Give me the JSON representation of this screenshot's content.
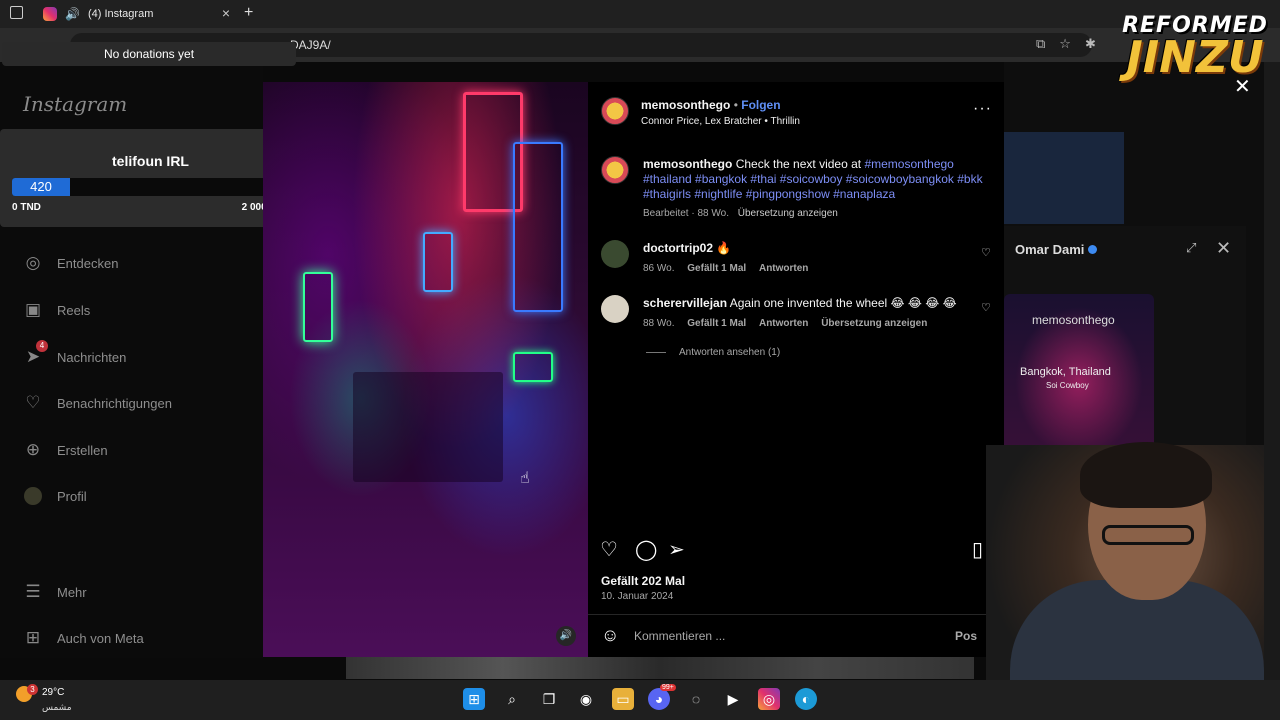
{
  "browser": {
    "tab_title": "(4) Instagram",
    "url_fragment": "DAJ9A/"
  },
  "overlay": {
    "donations_text": "No donations yet",
    "goal": {
      "title": "telifoun IRL",
      "current": "420",
      "min_label": "0 TND",
      "max_label": "2 000 TND",
      "progress_fraction": 0.21
    },
    "logo_line1": "REFORMED",
    "logo_line2": "JINZU"
  },
  "sidebar": {
    "logo": "Instagram",
    "items": [
      {
        "label": "Entdecken",
        "icon": "compass-icon"
      },
      {
        "label": "Reels",
        "icon": "reels-icon"
      },
      {
        "label": "Nachrichten",
        "icon": "messenger-icon",
        "badge": "4"
      },
      {
        "label": "Benachrichtigungen",
        "icon": "heart-icon"
      },
      {
        "label": "Erstellen",
        "icon": "plus-square-icon"
      },
      {
        "label": "Profil",
        "icon": "avatar-icon"
      },
      {
        "label": "Mehr",
        "icon": "menu-icon"
      },
      {
        "label": "Auch von Meta",
        "icon": "meta-grid-icon"
      }
    ]
  },
  "post": {
    "author": "memosonthego",
    "follow": "Folgen",
    "audio": "Connor Price, Lex Bratcher",
    "audio_track": "Thrillin",
    "caption_text": "Check the next video at",
    "caption_mention": "#memosonthego",
    "caption_tags": "#thailand #bangkok #thai #soicowboy #soicowboybangkok #bkk #thaigirls #nightlife #pingpongshow #nanaplaza",
    "caption_meta": "Bearbeitet · 88 Wo.",
    "caption_translate": "Übersetzung anzeigen",
    "comments": [
      {
        "user": "doctortrip02",
        "text": "🔥",
        "age": "86 Wo.",
        "likes": "Gefällt 1 Mal",
        "reply": "Antworten",
        "translate": ""
      },
      {
        "user": "scherervillejan",
        "text": "Again one invented the wheel 😂 😂 😂 😂",
        "age": "88 Wo.",
        "likes": "Gefällt 1 Mal",
        "reply": "Antworten",
        "translate": "Übersetzung anzeigen"
      }
    ],
    "view_replies": "Antworten ansehen (1)",
    "likes": "Gefällt 202 Mal",
    "date": "10. Januar 2024",
    "comment_placeholder": "Kommentieren ...",
    "post_button": "Pos"
  },
  "dm": {
    "name": "Omar Dami",
    "card_user": "memosonthego",
    "card_location": "Bangkok, Thailand",
    "card_sublocation": "Soi Cowboy"
  },
  "taskbar": {
    "temperature": "29°C",
    "condition": "مشمس",
    "weather_badge": "3",
    "discord_badge": "99+"
  },
  "colors": {
    "accent_blue": "#7d8ef5",
    "goal_fill": "#1f6bd6",
    "background": "#000000"
  }
}
